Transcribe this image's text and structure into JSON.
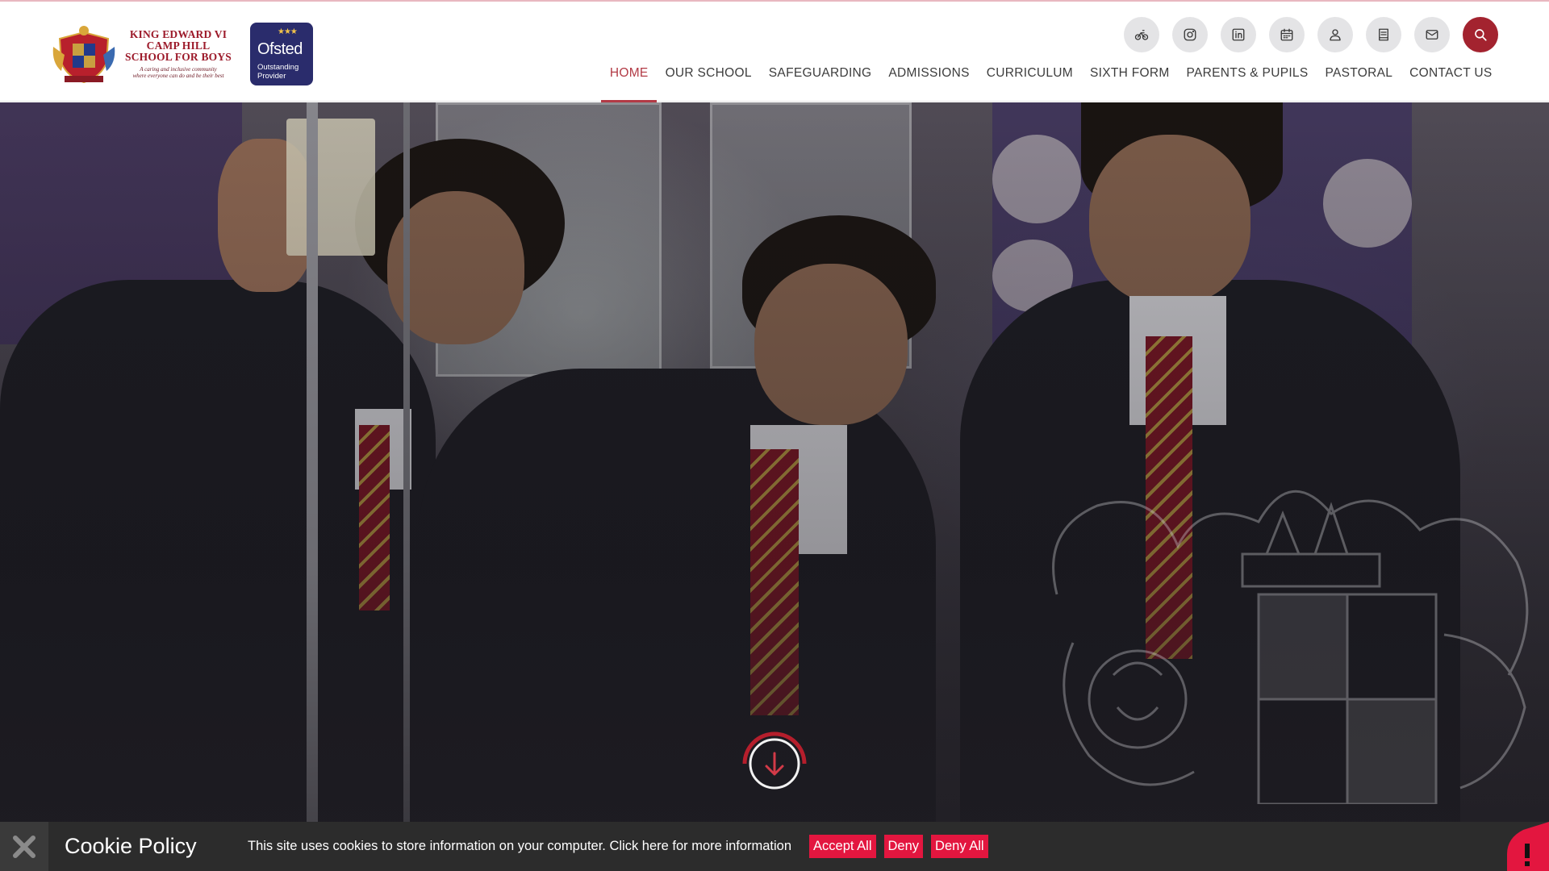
{
  "header": {
    "school": {
      "name_line1": "KING EDWARD VI",
      "name_line2": "CAMP HILL",
      "name_line3": "SCHOOL FOR BOYS",
      "tagline_line1": "A caring and inclusive community",
      "tagline_line2": "where everyone can do and be their best"
    },
    "ofsted": {
      "word": "Ofsted",
      "sub_line1": "Outstanding",
      "sub_line2": "Provider"
    },
    "icons": [
      "cycling-icon",
      "instagram-icon",
      "linkedin-icon",
      "calendar-icon",
      "user-icon",
      "book-icon",
      "mail-icon",
      "search-icon"
    ],
    "nav": [
      {
        "label": "HOME",
        "active": true
      },
      {
        "label": "OUR SCHOOL"
      },
      {
        "label": "SAFEGUARDING"
      },
      {
        "label": "ADMISSIONS"
      },
      {
        "label": "CURRICULUM"
      },
      {
        "label": "SIXTH FORM"
      },
      {
        "label": "PARENTS & PUPILS"
      },
      {
        "label": "PASTORAL"
      },
      {
        "label": "CONTACT US"
      }
    ]
  },
  "colors": {
    "brand": "#a3232f",
    "nav_active": "#b23a45",
    "cookie_button": "#e3163f",
    "cookie_bar": "#2c2c2c"
  },
  "cookie": {
    "title": "Cookie Policy",
    "text": "This site uses cookies to store information on your computer. Click here for more information",
    "accept_all": "Accept All",
    "deny": "Deny",
    "deny_all": "Deny All"
  }
}
